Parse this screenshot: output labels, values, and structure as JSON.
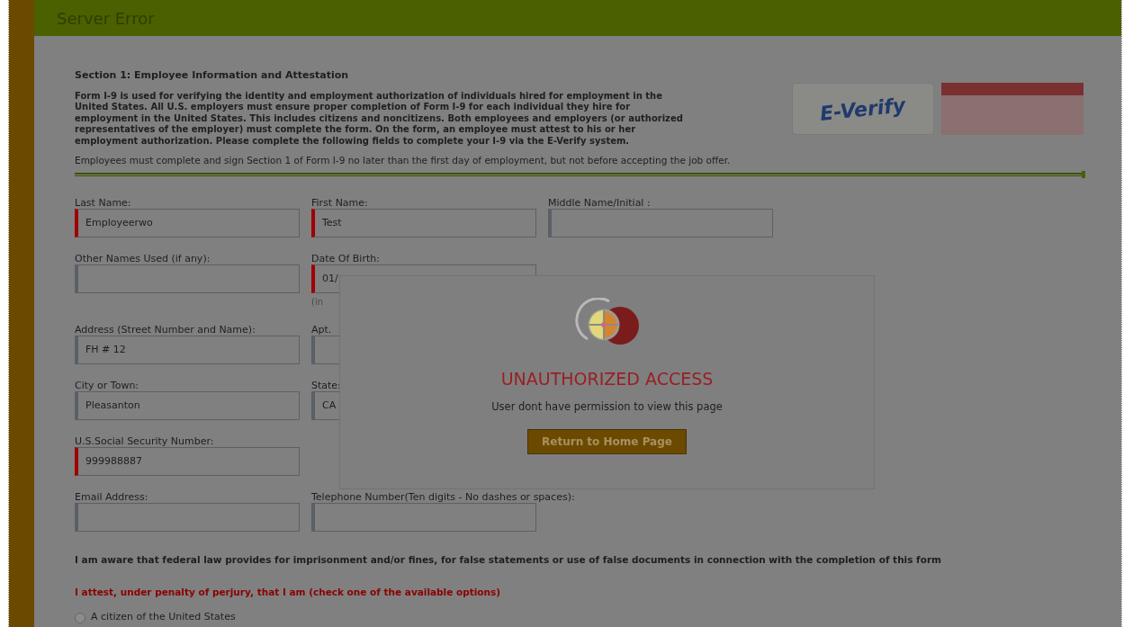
{
  "header": {
    "title": "Server Error"
  },
  "section": {
    "title": "Section 1: Employee Information and Attestation",
    "intro": "Form I-9 is used for verifying the identity and employment authorization of individuals hired for employment in the United States. All U.S. employers must ensure proper completion of Form I-9 for each individual they hire for employment in the United States. This includes citizens and noncitizens. Both employees and employers (or authorized representatives of the employer) must complete the form. On the form, an employee must attest to his or her employment authorization. Please complete the following fields to complete your I-9 via the E-Verify system.",
    "note": "Employees must complete and sign Section 1 of Form I-9 no later than the first day of employment, but not before accepting the job offer.",
    "logo": "E-Verify"
  },
  "field_rows": [
    [
      {
        "label": "Last Name:",
        "value": "Employeerwo",
        "required": true
      },
      {
        "label": "First Name:",
        "value": "Test",
        "required": true
      },
      {
        "label": "Middle Name/Initial :",
        "required": false
      }
    ],
    [
      {
        "label": "Other Names Used (if any):",
        "required": false
      },
      {
        "label": "Date Of Birth:",
        "value": "01/",
        "required": true,
        "hint": "(in"
      }
    ],
    [
      {
        "label": "Address (Street Number and Name):",
        "value": "FH # 12",
        "required": false
      },
      {
        "label": "Apt.",
        "required": false
      }
    ],
    [
      {
        "label": "City or Town:",
        "value": "Pleasanton",
        "required": false
      },
      {
        "label": "State:",
        "value": "CA",
        "required": false
      }
    ],
    [
      {
        "label": "U.S.Social Security Number:",
        "value": "999988887",
        "required": true
      }
    ],
    [
      {
        "label": "Email Address:",
        "required": false
      },
      {
        "label": "Telephone Number(Ten digits - No dashes or spaces):",
        "required": false
      }
    ]
  ],
  "notice": "I am aware that federal law provides for imprisonment and/or fines, for false statements or use of false documents in connection with the completion of this form",
  "attest": "I attest, under penalty of perjury, that I am (check one of the available options)",
  "options": [
    {
      "label": "A citizen of the United States",
      "selected": false
    }
  ],
  "dialog": {
    "title": "UNAUTHORIZED ACCESS",
    "message": "User dont have permission to view this page",
    "button": "Return to Home Page"
  }
}
